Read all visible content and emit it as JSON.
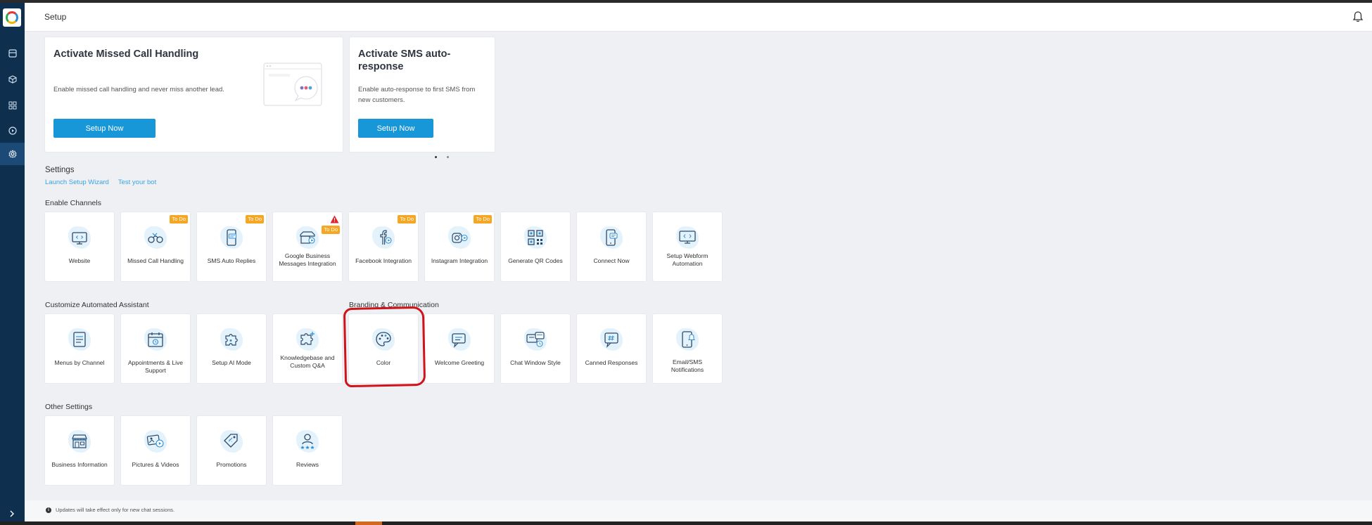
{
  "header": {
    "title": "Setup"
  },
  "promo_cards": [
    {
      "title": "Activate Missed Call Handling",
      "description": "Enable missed call handling and never miss another lead.",
      "button": "Setup Now"
    },
    {
      "title": "Activate SMS auto-response",
      "description": "Enable auto-response to first SMS from new customers.",
      "button": "Setup Now"
    }
  ],
  "settings": {
    "title": "Settings",
    "links": [
      "Launch Setup Wizard",
      "Test your bot"
    ]
  },
  "sections": {
    "enable_channels": "Enable Channels",
    "customize_assistant": "Customize Automated Assistant",
    "branding": "Branding & Communication",
    "other": "Other Settings"
  },
  "badges": {
    "todo": "To Do"
  },
  "tiles": {
    "channels": [
      {
        "label": "Website",
        "icon": "monitor-icon"
      },
      {
        "label": "Missed Call Handling",
        "icon": "missed-call-icon",
        "badge": "todo"
      },
      {
        "label": "SMS Auto Replies",
        "icon": "sms-phone-icon",
        "badge": "todo"
      },
      {
        "label": "Google Business Messages Integration",
        "icon": "google-business-icon",
        "badge": "todo",
        "warning": true
      },
      {
        "label": "Facebook Integration",
        "icon": "facebook-icon",
        "badge": "todo"
      },
      {
        "label": "Instagram Integration",
        "icon": "instagram-icon",
        "badge": "todo"
      },
      {
        "label": "Generate QR Codes",
        "icon": "qr-code-icon"
      },
      {
        "label": "Connect Now",
        "icon": "connect-phone-icon"
      },
      {
        "label": "Setup Webform Automation",
        "icon": "webform-icon"
      }
    ],
    "assistant": [
      {
        "label": "Menus by Channel",
        "icon": "menu-icon"
      },
      {
        "label": "Appointments & Live Support",
        "icon": "calendar-icon"
      },
      {
        "label": "Setup AI Mode",
        "icon": "puzzle-icon"
      },
      {
        "label": "Knowledgebase and Custom Q&A",
        "icon": "puzzle-plus-icon"
      }
    ],
    "branding": [
      {
        "label": "Color",
        "icon": "palette-icon"
      },
      {
        "label": "Welcome Greeting",
        "icon": "chat-bubble-icon"
      },
      {
        "label": "Chat Window Style",
        "icon": "chat-window-icon"
      },
      {
        "label": "Canned Responses",
        "icon": "hashtag-chat-icon"
      },
      {
        "label": "Email/SMS Notifications",
        "icon": "notification-phone-icon"
      }
    ],
    "other": [
      {
        "label": "Business Information",
        "icon": "storefront-icon"
      },
      {
        "label": "Pictures & Videos",
        "icon": "media-icon"
      },
      {
        "label": "Promotions",
        "icon": "tag-icon"
      },
      {
        "label": "Reviews",
        "icon": "reviews-icon"
      }
    ]
  },
  "footer": {
    "note": "Updates will take effect only for new chat sessions."
  },
  "colors": {
    "accent": "#1796d8",
    "sidebar": "#0f2f4f",
    "badge": "#f5a623",
    "highlight": "#d0131b"
  }
}
